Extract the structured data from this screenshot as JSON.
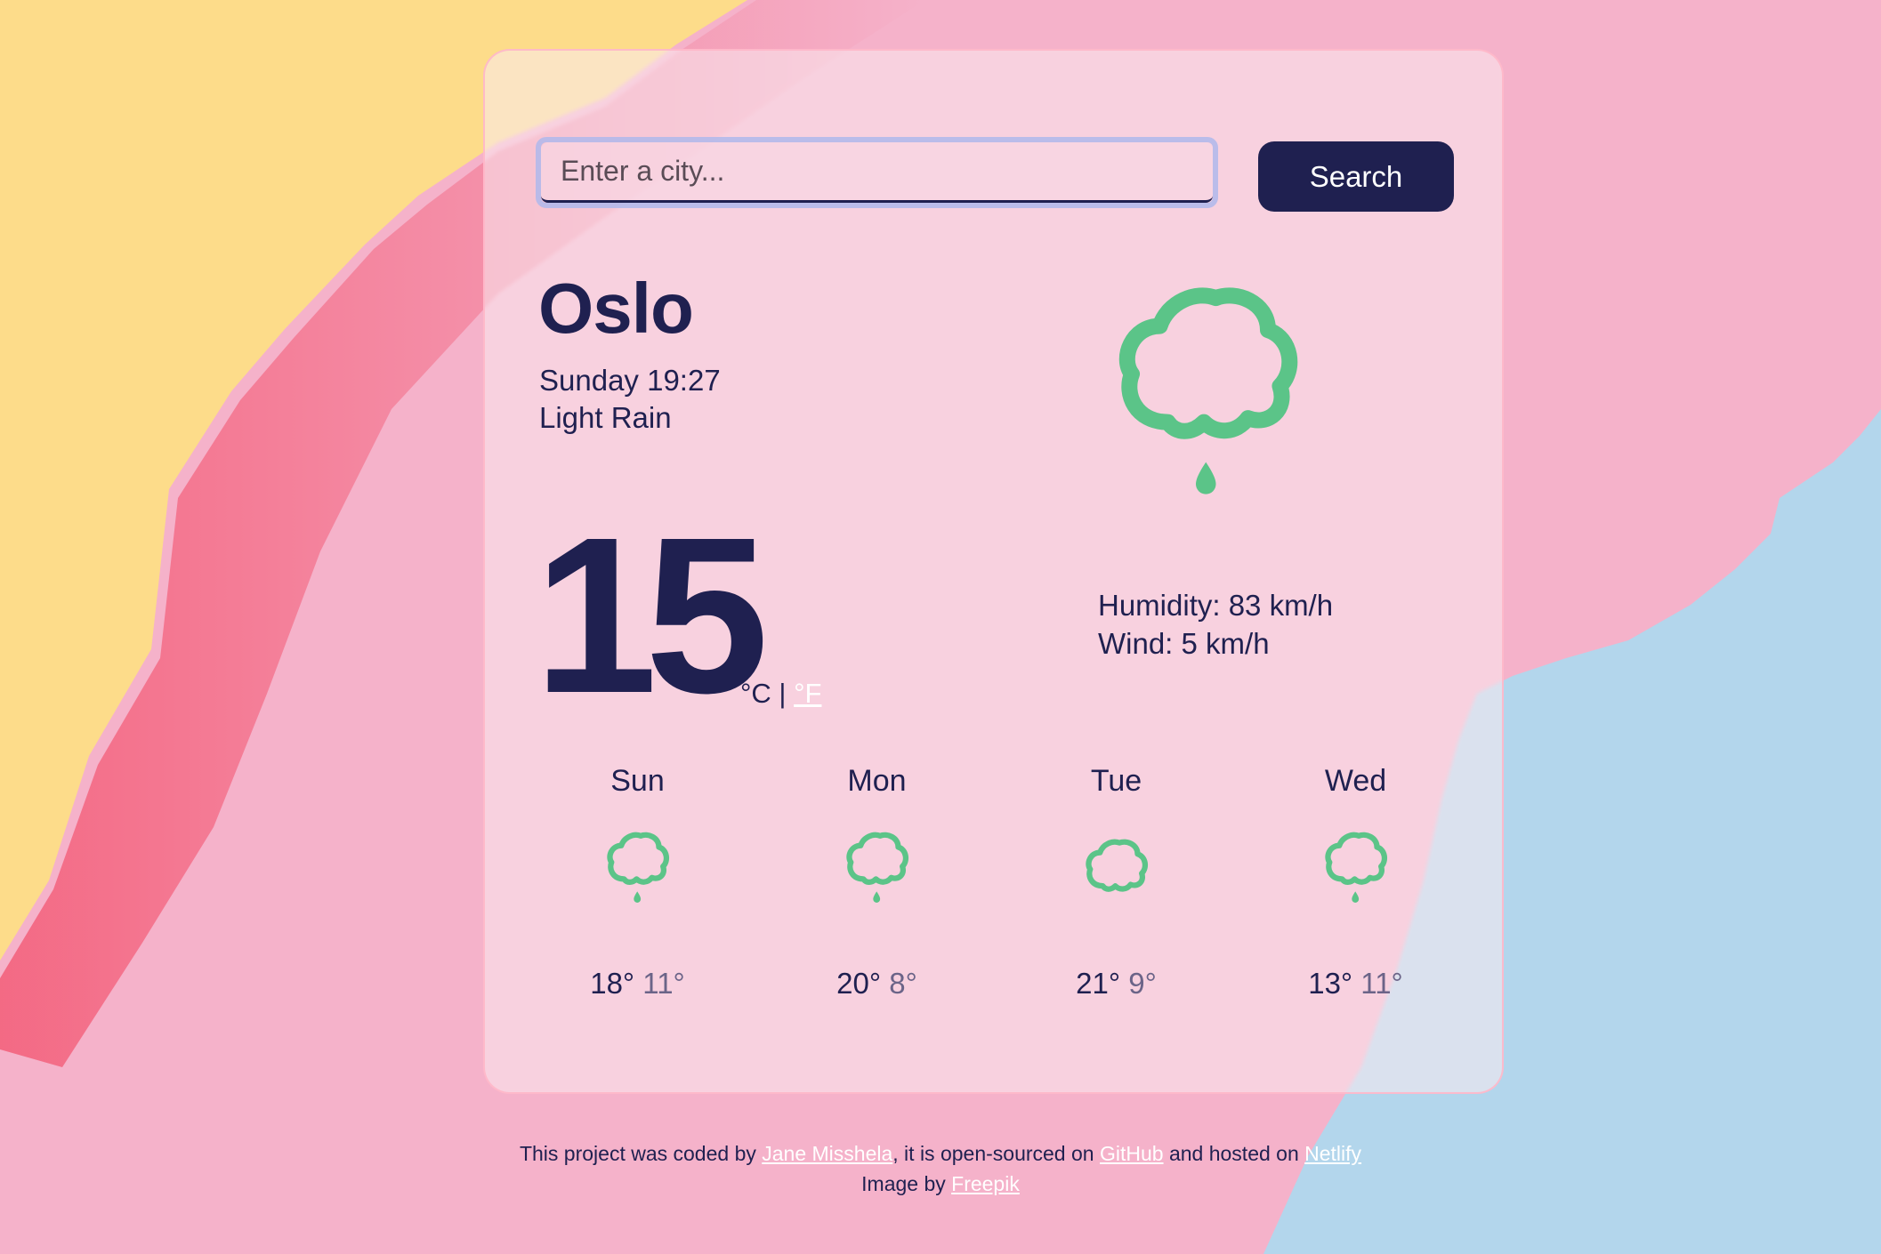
{
  "search": {
    "placeholder": "Enter a city...",
    "value": "",
    "button_label": "Search"
  },
  "current": {
    "city": "Oslo",
    "datetime": "Sunday 19:27",
    "description": "Light Rain",
    "temperature": "15",
    "unit_celsius": "°C",
    "unit_separator": "|",
    "unit_fahrenheit": "°F",
    "icon": "rain-cloud-icon",
    "humidity": "Humidity: 83 km/h",
    "wind": "Wind: 5 km/h"
  },
  "forecast": [
    {
      "day": "Sun",
      "icon": "rain-cloud-icon",
      "max": "18°",
      "min": "11°"
    },
    {
      "day": "Mon",
      "icon": "rain-cloud-icon",
      "max": "20°",
      "min": "8°"
    },
    {
      "day": "Tue",
      "icon": "cloud-icon",
      "max": "21°",
      "min": "9°"
    },
    {
      "day": "Wed",
      "icon": "rain-cloud-icon",
      "max": "13°",
      "min": "11°"
    }
  ],
  "footer": {
    "line1_prefix": "This project was coded by ",
    "author_link": "Jane Misshela",
    "line1_mid": ", it is open-sourced on ",
    "github_link": "GitHub",
    "line1_mid2": " and hosted on ",
    "netlify_link": "Netlify",
    "line2_prefix": "Image by ",
    "freepik_link": "Freepik"
  },
  "colors": {
    "primary": "#1f2050",
    "icon_green": "#5bc488",
    "bg_yellow": "#fddc8a",
    "bg_pink": "#f5b2ca",
    "bg_red": "#f2697f",
    "bg_blue": "#b3d6ec"
  }
}
